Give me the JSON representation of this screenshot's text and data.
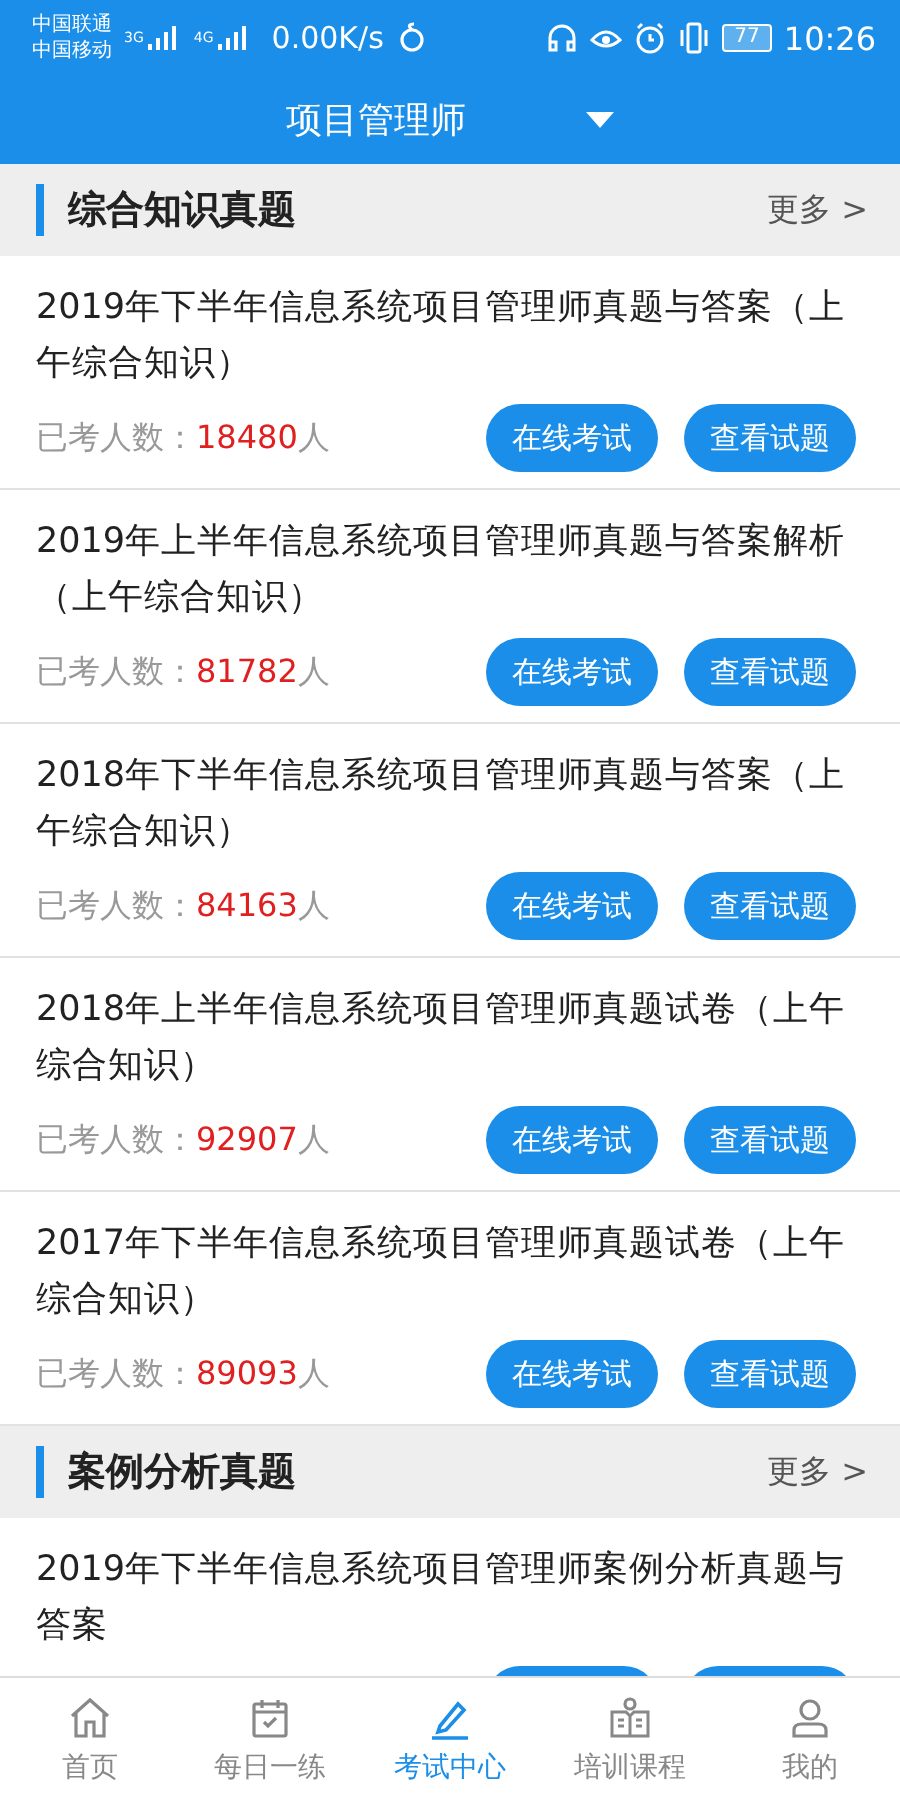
{
  "status_bar": {
    "carriers": [
      "中国联通",
      "中国移动"
    ],
    "network_badges": [
      "3G",
      "4G"
    ],
    "speed": "0.00K/s",
    "battery": "77",
    "time": "10:26"
  },
  "header": {
    "title": "项目管理师"
  },
  "sections": [
    {
      "title": "综合知识真题",
      "more": "更多 >",
      "items": [
        {
          "title": "2019年下半年信息系统项目管理师真题与答案（上午综合知识）",
          "count_label": "已考人数：",
          "count": "18480",
          "unit": "人",
          "buttons": [
            "在线考试",
            "查看试题"
          ]
        },
        {
          "title": "2019年上半年信息系统项目管理师真题与答案解析（上午综合知识）",
          "count_label": "已考人数：",
          "count": "81782",
          "unit": "人",
          "buttons": [
            "在线考试",
            "查看试题"
          ]
        },
        {
          "title": "2018年下半年信息系统项目管理师真题与答案（上午综合知识）",
          "count_label": "已考人数：",
          "count": "84163",
          "unit": "人",
          "buttons": [
            "在线考试",
            "查看试题"
          ]
        },
        {
          "title": "2018年上半年信息系统项目管理师真题试卷（上午综合知识）",
          "count_label": "已考人数：",
          "count": "92907",
          "unit": "人",
          "buttons": [
            "在线考试",
            "查看试题"
          ]
        },
        {
          "title": "2017年下半年信息系统项目管理师真题试卷（上午综合知识）",
          "count_label": "已考人数：",
          "count": "89093",
          "unit": "人",
          "buttons": [
            "在线考试",
            "查看试题"
          ]
        }
      ]
    },
    {
      "title": "案例分析真题",
      "more": "更多 >",
      "items": [
        {
          "title": "2019年下半年信息系统项目管理师案例分析真题与答案"
        }
      ]
    }
  ],
  "nav": [
    {
      "label": "首页",
      "kind": "home",
      "selected": false
    },
    {
      "label": "每日一练",
      "kind": "calendar",
      "selected": false
    },
    {
      "label": "考试中心",
      "kind": "pencil",
      "selected": true
    },
    {
      "label": "培训课程",
      "kind": "book",
      "selected": false
    },
    {
      "label": "我的",
      "kind": "person",
      "selected": false
    }
  ]
}
